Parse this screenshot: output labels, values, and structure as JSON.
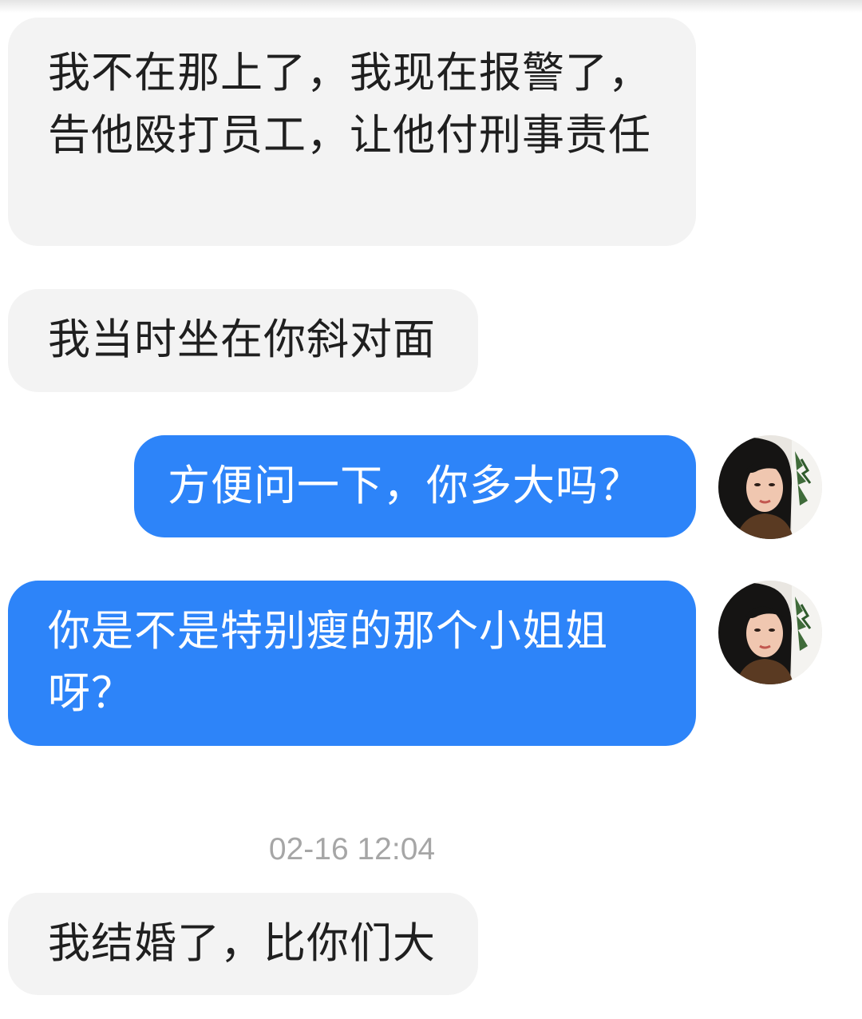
{
  "messages": [
    {
      "side": "incoming",
      "text": "我不在那上了，我现在报警了，告他殴打员工，让他付刑事责任"
    },
    {
      "side": "incoming",
      "text": "我当时坐在你斜对面"
    },
    {
      "side": "outgoing",
      "text": "方便问一下，你多大吗？"
    },
    {
      "side": "outgoing",
      "text": "你是不是特别瘦的那个小姐姐呀？"
    },
    {
      "side": "incoming",
      "text": "我结婚了，比你们大"
    }
  ],
  "timestamp": "02-16 12:04",
  "colors": {
    "incoming_bubble": "#f3f3f3",
    "outgoing_bubble": "#2d84f9",
    "incoming_text": "#1f1f1f",
    "outgoing_text": "#ffffff",
    "timestamp_text": "#a6a6a6"
  },
  "avatar": {
    "icon": "user-avatar-photo"
  }
}
